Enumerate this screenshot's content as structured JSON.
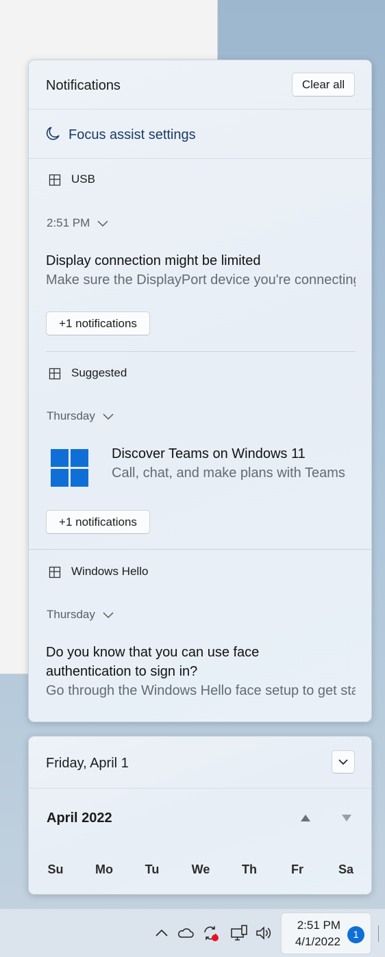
{
  "notification_center": {
    "title": "Notifications",
    "clear_all_label": "Clear all",
    "focus_assist_label": "Focus assist settings",
    "groups": [
      {
        "app": "USB",
        "time": "2:51 PM",
        "title": "Display connection might be limited",
        "body": "Make sure the DisplayPort device you're connecting to supports DisplayPort Alternate Mode",
        "more_label": "+1 notifications"
      },
      {
        "app": "Suggested",
        "time": "Thursday",
        "title": "Discover Teams on Windows 11",
        "body": "Call, chat, and make plans with Teams",
        "more_label": "+1 notifications"
      },
      {
        "app": "Windows Hello",
        "time": "Thursday",
        "title_line1": "Do you know that you can use face",
        "title_line2": "authentication to sign in?",
        "body": "Go through the Windows Hello face setup to get started"
      }
    ]
  },
  "calendar": {
    "date_header": "Friday, April 1",
    "month_label": "April 2022",
    "weekdays": [
      "Su",
      "Mo",
      "Tu",
      "We",
      "Th",
      "Fr",
      "Sa"
    ]
  },
  "taskbar": {
    "time": "2:51 PM",
    "date": "4/1/2022",
    "notification_count": "1",
    "icons": [
      "chevron-up-icon",
      "onedrive-cloud-icon",
      "sync-icon",
      "network-icon",
      "volume-icon"
    ]
  },
  "colors": {
    "accent": "#0f6fd6",
    "link": "#1a3a66",
    "recording_dot": "#e81123"
  }
}
